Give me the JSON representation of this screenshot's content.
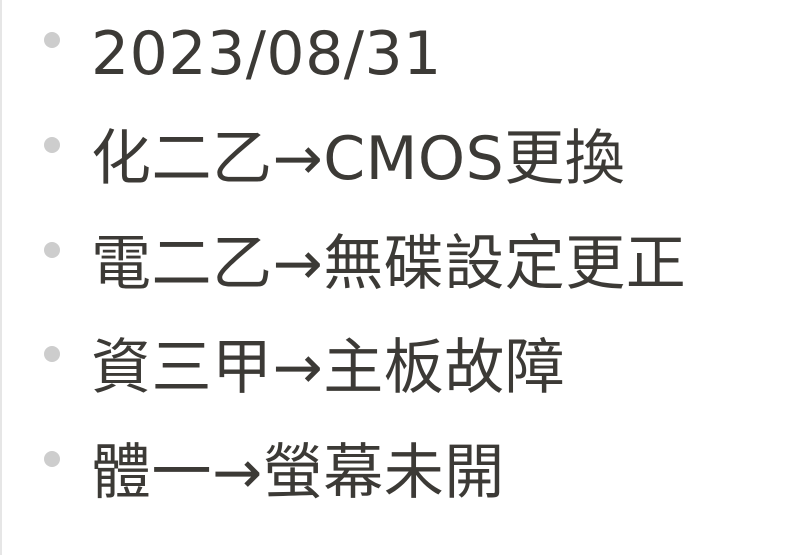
{
  "notes": {
    "items": [
      "2023/08/31",
      "化二乙→CMOS更換",
      "電二乙→無碟設定更正",
      "資三甲→主板故障",
      "體一→螢幕未開"
    ]
  },
  "colors": {
    "text": "#3c3a36",
    "bullet": "#cdcdcd",
    "background": "#ffffff"
  }
}
